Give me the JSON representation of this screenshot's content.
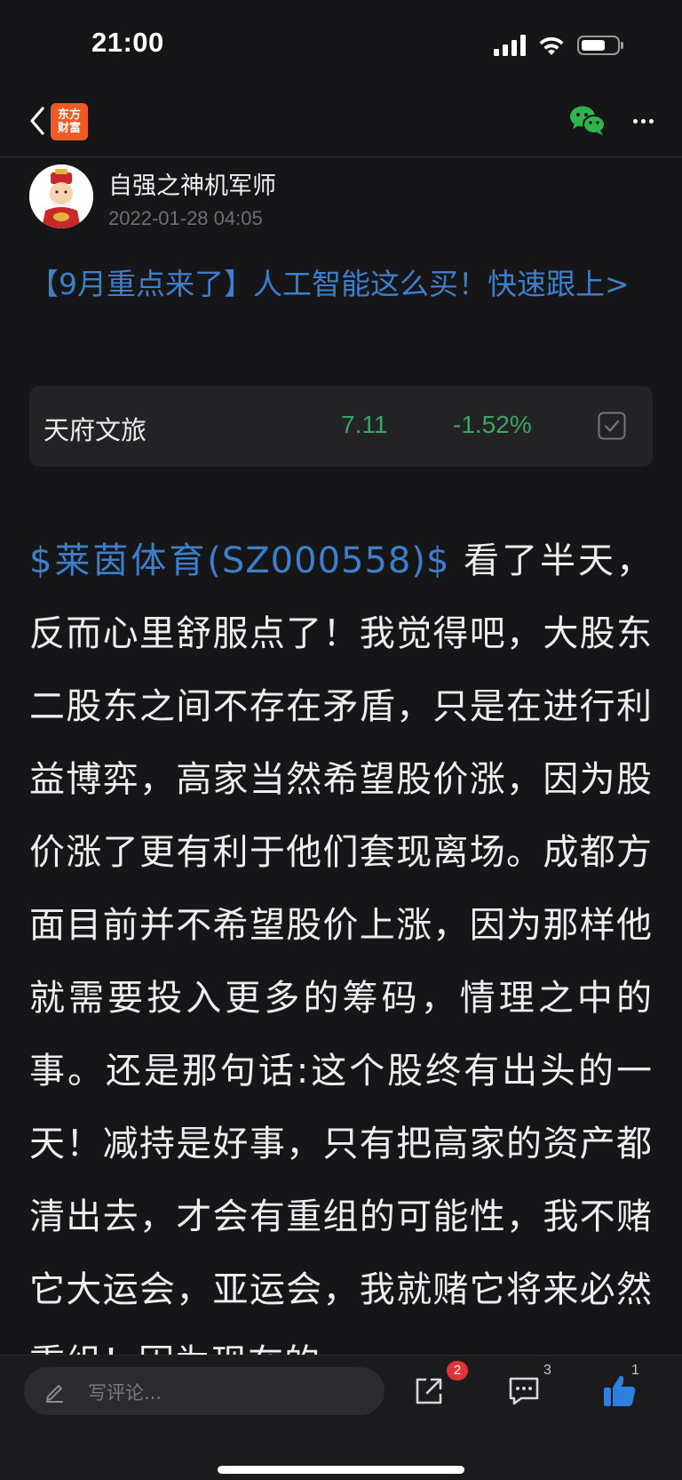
{
  "status_bar": {
    "time": "21:00"
  },
  "nav": {
    "logo_line1": "东方",
    "logo_line2": "财富",
    "logo_color": "#ee5a24",
    "icons": [
      "chevron-left-icon",
      "wechat-icon",
      "more-icon"
    ]
  },
  "author": {
    "name": "自强之神机军师",
    "timestamp": "2022-01-28 04:05"
  },
  "promo": {
    "text": "【9月重点来了】人工智能这么买！快速跟上>"
  },
  "stock": {
    "name": "天府文旅",
    "price": "7.11",
    "change": "-1.52%",
    "change_color": "#3aa564"
  },
  "post": {
    "stock_tag": "$莱茵体育(SZ000558)$",
    "text": "看了半天，反而心里舒服点了！我觉得吧，大股东二股东之间不存在矛盾，只是在进行利益博弈，高家当然希望股价涨，因为股价涨了更有利于他们套现离场。成都方面目前并不希望股价上涨，因为那样他就需要投入更多的筹码，情理之中的事。还是那句话:这个股终有出头的一天！减持是好事，只有把高家的资产都清出去，才会有重组的可能性，我不赌它大运会，亚运会，我就赌它将来必然重组！因为现在的"
  },
  "bottom_bar": {
    "comment_placeholder": "写评论...",
    "share_badge": "2",
    "comment_count": "3",
    "like_count": "1",
    "accent_color": "#2f7fe0"
  }
}
